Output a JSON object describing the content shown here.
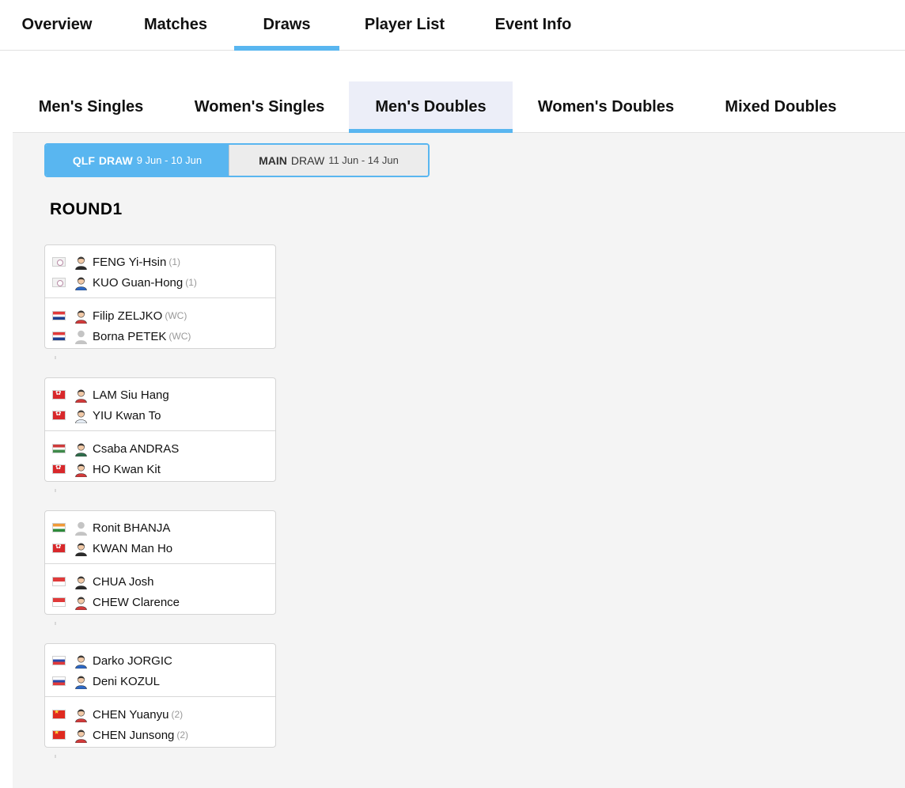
{
  "nav": {
    "tabs": [
      {
        "label": "Overview"
      },
      {
        "label": "Matches"
      },
      {
        "label": "Draws"
      },
      {
        "label": "Player List"
      },
      {
        "label": "Event Info"
      }
    ],
    "active": "Draws"
  },
  "events": {
    "tabs": [
      {
        "label": "Men's Singles"
      },
      {
        "label": "Women's Singles"
      },
      {
        "label": "Men's Doubles"
      },
      {
        "label": "Women's Doubles"
      },
      {
        "label": "Mixed Doubles"
      }
    ],
    "active": "Men's Doubles"
  },
  "draw_toggle": {
    "qlf": {
      "strong": "QLF",
      "rest": "DRAW",
      "dates": "9 Jun - 10 Jun"
    },
    "main": {
      "strong": "MAIN",
      "rest": "DRAW",
      "dates": "11 Jun - 14 Jun"
    },
    "selected": "qlf"
  },
  "round": {
    "title": "ROUND1"
  },
  "colors": {
    "accent": "#59b6f0",
    "main_bg": "#f4f4f4",
    "active_event_bg": "#eceef8"
  },
  "matches": [
    {
      "pairs": [
        {
          "players": [
            {
              "flag": "tpe",
              "avatar": "player-avatar-dark",
              "name": "FENG Yi-Hsin",
              "seed": "(1)"
            },
            {
              "flag": "tpe",
              "avatar": "player-avatar-blue",
              "name": "KUO Guan-Hong",
              "seed": "(1)"
            }
          ]
        },
        {
          "players": [
            {
              "flag": "cro",
              "avatar": "player-avatar-red",
              "name": "Filip ZELJKO",
              "seed": "(WC)"
            },
            {
              "flag": "cro",
              "avatar": "default-avatar",
              "name": "Borna PETEK",
              "seed": "(WC)"
            }
          ]
        }
      ]
    },
    {
      "pairs": [
        {
          "players": [
            {
              "flag": "hkg",
              "avatar": "player-avatar-red",
              "name": "LAM Siu Hang",
              "seed": ""
            },
            {
              "flag": "hkg",
              "avatar": "player-avatar-light",
              "name": "YIU Kwan To",
              "seed": ""
            }
          ]
        },
        {
          "players": [
            {
              "flag": "hun",
              "avatar": "player-avatar-green",
              "name": "Csaba ANDRAS",
              "seed": ""
            },
            {
              "flag": "hkg",
              "avatar": "player-avatar-red",
              "name": "HO Kwan Kit",
              "seed": ""
            }
          ]
        }
      ]
    },
    {
      "pairs": [
        {
          "players": [
            {
              "flag": "ind",
              "avatar": "default-avatar",
              "name": "Ronit BHANJA",
              "seed": ""
            },
            {
              "flag": "hkg",
              "avatar": "player-avatar-dark",
              "name": "KWAN Man Ho",
              "seed": ""
            }
          ]
        },
        {
          "players": [
            {
              "flag": "sgp",
              "avatar": "player-avatar-dark",
              "name": "CHUA Josh",
              "seed": ""
            },
            {
              "flag": "sgp",
              "avatar": "player-avatar-red",
              "name": "CHEW Clarence",
              "seed": ""
            }
          ]
        }
      ]
    },
    {
      "pairs": [
        {
          "players": [
            {
              "flag": "slo",
              "avatar": "player-avatar-blue",
              "name": "Darko JORGIC",
              "seed": ""
            },
            {
              "flag": "slo",
              "avatar": "player-avatar-blue",
              "name": "Deni KOZUL",
              "seed": ""
            }
          ]
        },
        {
          "players": [
            {
              "flag": "chn",
              "avatar": "player-avatar-red",
              "name": "CHEN Yuanyu",
              "seed": "(2)"
            },
            {
              "flag": "chn",
              "avatar": "player-avatar-red",
              "name": "CHEN Junsong",
              "seed": "(2)"
            }
          ]
        }
      ]
    }
  ]
}
